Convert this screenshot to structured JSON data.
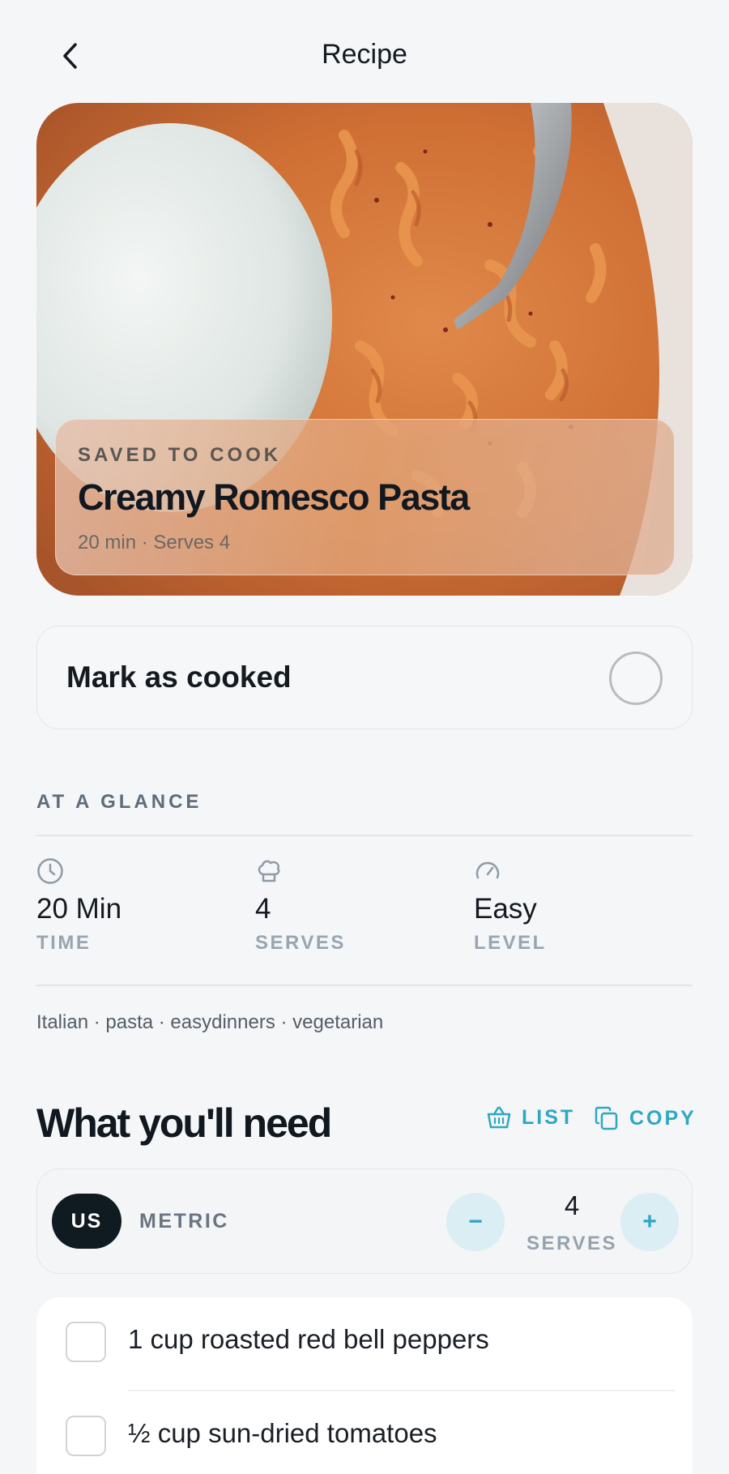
{
  "header": {
    "title": "Recipe"
  },
  "hero": {
    "eyebrow": "SAVED TO COOK",
    "title": "Creamy Romesco Pasta",
    "meta": "20 min · Serves 4"
  },
  "cooked": {
    "label": "Mark as cooked",
    "checked": false
  },
  "glance": {
    "heading": "AT A GLANCE",
    "stats": [
      {
        "icon": "clock-icon",
        "value": "20 Min",
        "label": "TIME"
      },
      {
        "icon": "chef-hat-icon",
        "value": "4",
        "label": "SERVES"
      },
      {
        "icon": "gauge-icon",
        "value": "Easy",
        "label": "LEVEL"
      }
    ]
  },
  "tags": "Italian · pasta · easydinners · vegetarian",
  "ingredients_section": {
    "title": "What you'll need",
    "list_label": "LIST",
    "copy_label": "COPY",
    "units": {
      "us": "US",
      "metric": "METRIC",
      "selected": "US"
    },
    "stepper": {
      "minus": "−",
      "plus": "+",
      "count": "4",
      "label": "SERVES"
    },
    "items": [
      {
        "text": "1 cup roasted red bell peppers",
        "checked": false
      },
      {
        "text": "½ cup sun-dried tomatoes",
        "checked": false
      }
    ]
  },
  "colors": {
    "accent": "#2fa7c4",
    "dark": "#0f1a21",
    "background": "#f4f6f8"
  }
}
